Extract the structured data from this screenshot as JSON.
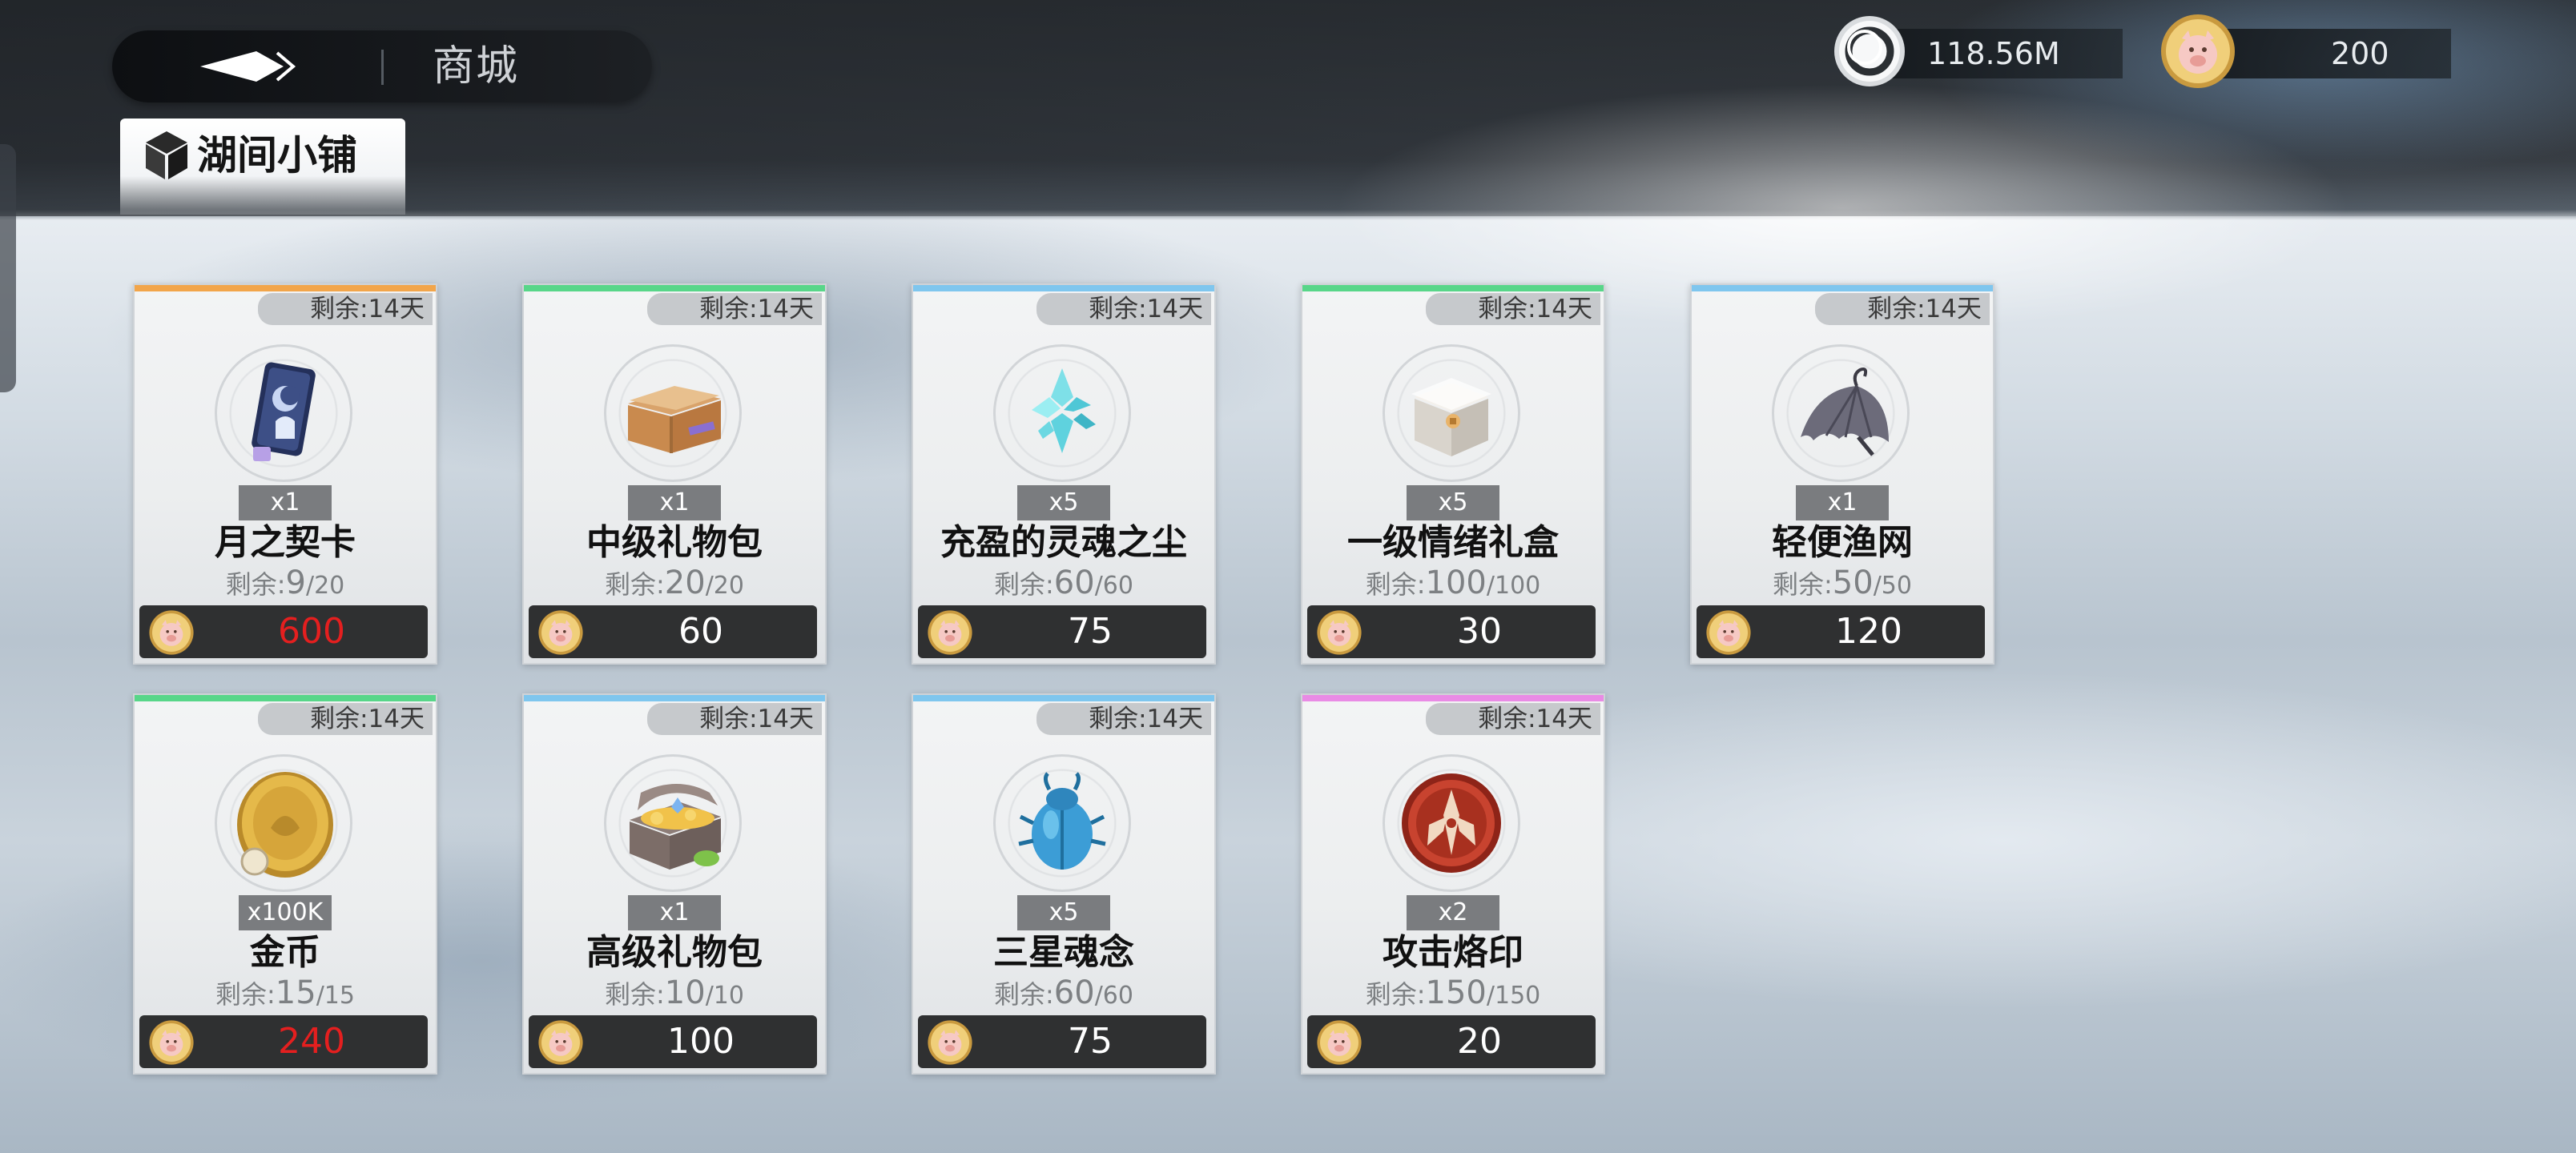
{
  "header": {
    "title": "商城",
    "shop_tab": "湖间小铺"
  },
  "currencies": [
    {
      "name": "silver-ring-currency",
      "value": "118.56M"
    },
    {
      "name": "pig-coin-currency",
      "value": "200"
    }
  ],
  "accent_colors": {
    "orange": "#f2a54a",
    "green": "#58d689",
    "blue": "#7fc6ee",
    "pink": "#e98be5",
    "price_red": "#e41f1f"
  },
  "items": [
    {
      "remaining_time": "剩余:14天",
      "icon": "moon-contract-card-icon",
      "quantity": "x1",
      "name": "月之契卡",
      "stock_label": "剩余:",
      "stock": "9",
      "stock_total": "/20",
      "price": "600",
      "price_red": true,
      "rarity": "orange"
    },
    {
      "remaining_time": "剩余:14天",
      "icon": "gift-box-open-icon",
      "quantity": "x1",
      "name": "中级礼物包",
      "stock_label": "剩余:",
      "stock": "20",
      "stock_total": "/20",
      "price": "60",
      "price_red": false,
      "rarity": "green"
    },
    {
      "remaining_time": "剩余:14天",
      "icon": "soul-dust-crystal-icon",
      "quantity": "x5",
      "name": "充盈的灵魂之尘",
      "stock_label": "剩余:",
      "stock": "60",
      "stock_total": "/60",
      "price": "75",
      "price_red": false,
      "rarity": "blue"
    },
    {
      "remaining_time": "剩余:14天",
      "icon": "emotion-gift-box-icon",
      "quantity": "x5",
      "name": "一级情绪礼盒",
      "stock_label": "剩余:",
      "stock": "100",
      "stock_total": "/100",
      "price": "30",
      "price_red": false,
      "rarity": "green"
    },
    {
      "remaining_time": "剩余:14天",
      "icon": "fishing-net-icon",
      "quantity": "x1",
      "name": "轻便渔网",
      "stock_label": "剩余:",
      "stock": "50",
      "stock_total": "/50",
      "price": "120",
      "price_red": false,
      "rarity": "blue"
    },
    {
      "remaining_time": "剩余:14天",
      "icon": "gold-coin-icon",
      "quantity": "x100K",
      "name": "金币",
      "stock_label": "剩余:",
      "stock": "15",
      "stock_total": "/15",
      "price": "240",
      "price_red": true,
      "rarity": "green"
    },
    {
      "remaining_time": "剩余:14天",
      "icon": "treasure-chest-icon",
      "quantity": "x1",
      "name": "高级礼物包",
      "stock_label": "剩余:",
      "stock": "10",
      "stock_total": "/10",
      "price": "100",
      "price_red": false,
      "rarity": "blue"
    },
    {
      "remaining_time": "剩余:14天",
      "icon": "blue-scarab-icon",
      "quantity": "x5",
      "name": "三星魂念",
      "stock_label": "剩余:",
      "stock": "60",
      "stock_total": "/60",
      "price": "75",
      "price_red": false,
      "rarity": "blue"
    },
    {
      "remaining_time": "剩余:14天",
      "icon": "attack-emblem-icon",
      "quantity": "x2",
      "name": "攻击烙印",
      "stock_label": "剩余:",
      "stock": "150",
      "stock_total": "/150",
      "price": "20",
      "price_red": false,
      "rarity": "pink"
    }
  ]
}
